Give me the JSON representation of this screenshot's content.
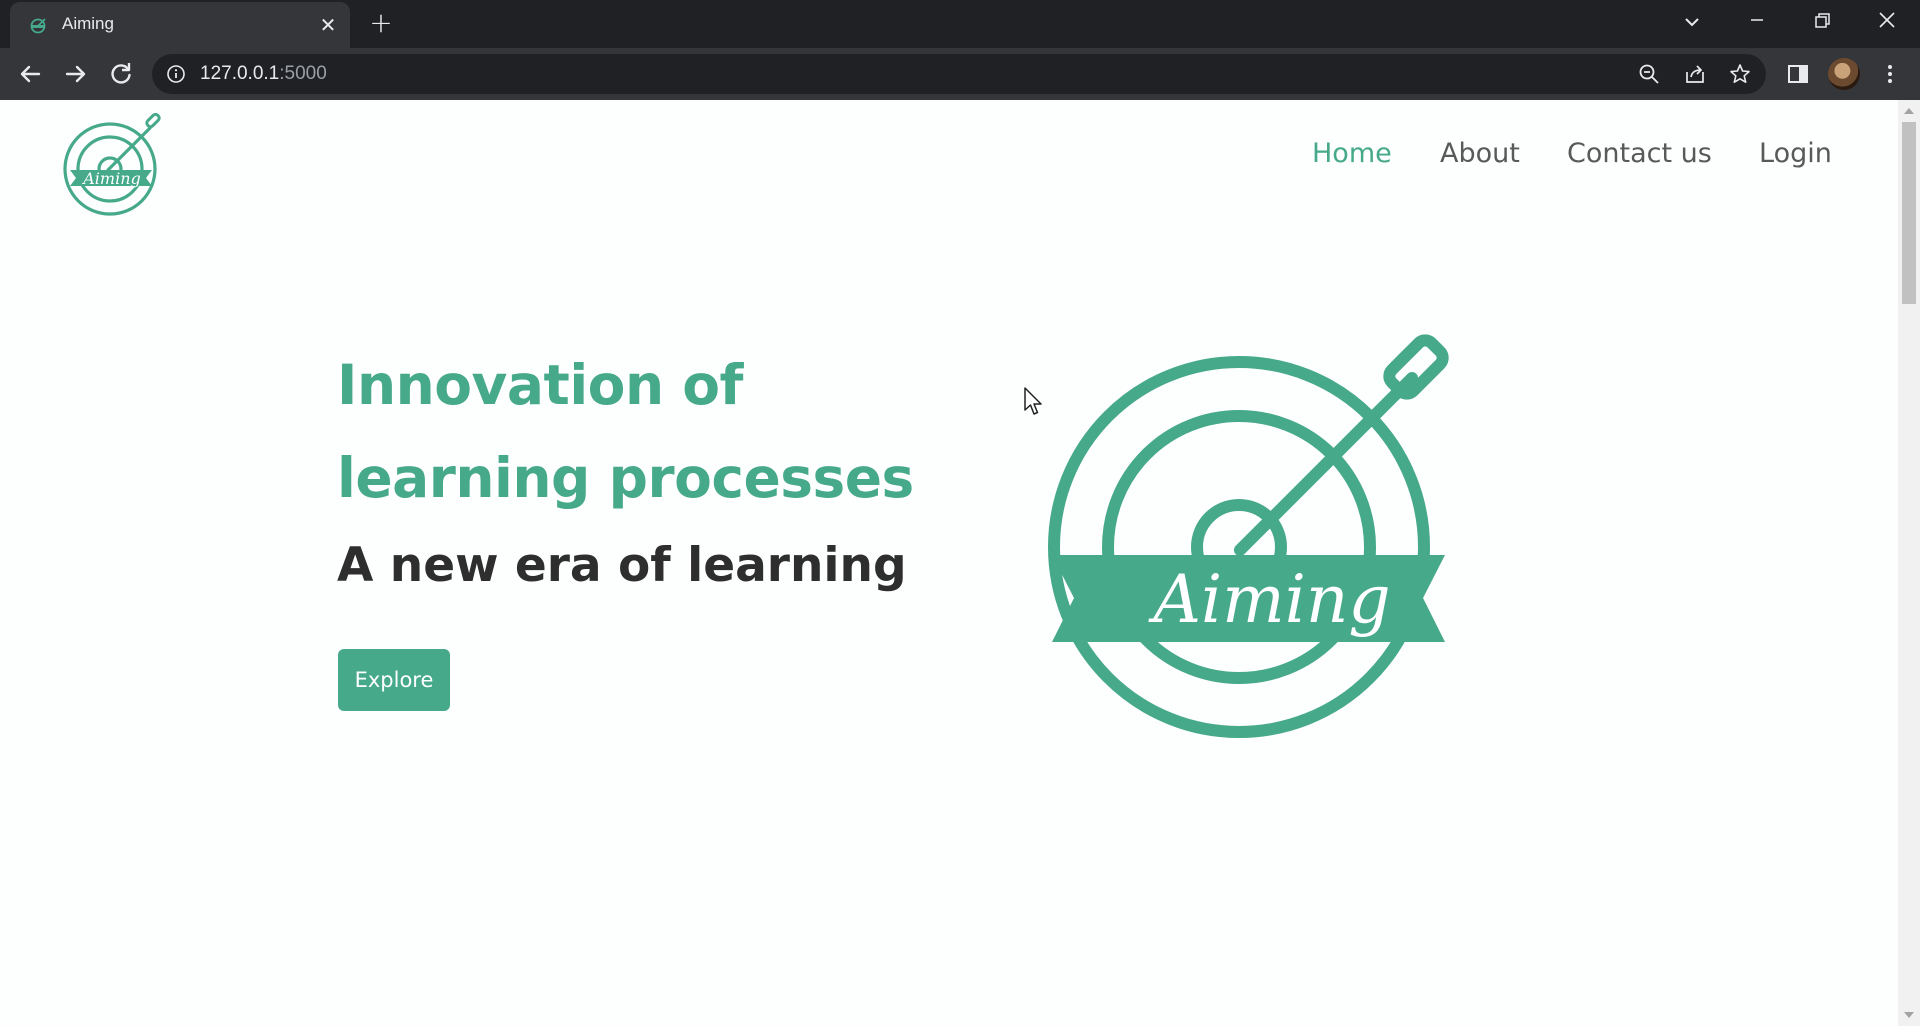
{
  "browser": {
    "tab_title": "Aiming",
    "tab_close": "✕",
    "new_tab": "+",
    "url_host": "127.0.0.1",
    "url_port": ":5000"
  },
  "site": {
    "logo_text": "Aiming",
    "nav": [
      "Home",
      "About",
      "Contact us",
      "Login"
    ],
    "active_nav": "Home"
  },
  "hero": {
    "title_line1": "Innovation of",
    "title_line2": "learning processes",
    "subtitle": "A new era of learning",
    "button_label": "Explore",
    "logo_text": "Aiming"
  },
  "colors": {
    "brand_green": "#45a98a",
    "heading_dark": "#2e2e2e",
    "nav_gray": "#595959"
  }
}
